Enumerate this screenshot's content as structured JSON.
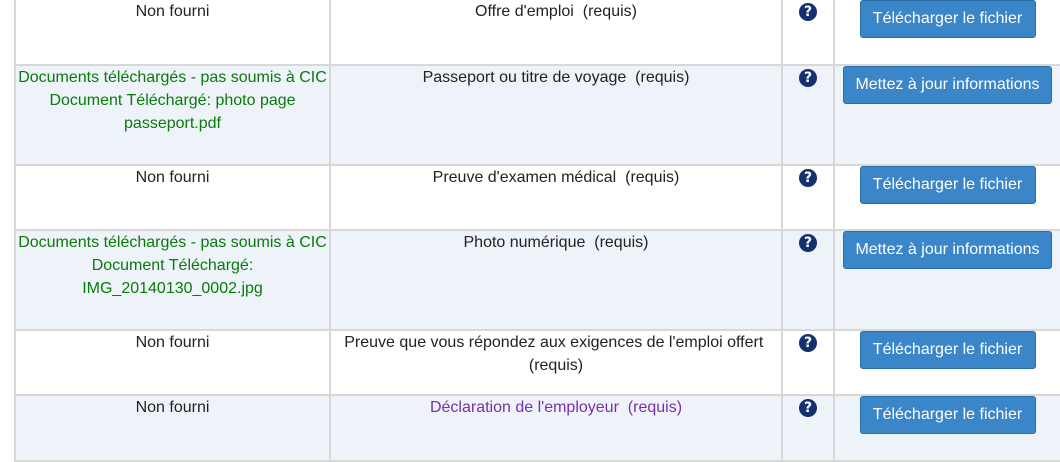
{
  "rows": [
    {
      "status_lines": [
        "Non fourni"
      ],
      "status_type": "not-provided",
      "document": "Offre d'emploi",
      "required": "(requis)",
      "help": "?",
      "action": "Télécharger le fichier"
    },
    {
      "status_lines": [
        "Documents téléchargés - pas soumis à CIC",
        "Document Téléchargé: photo page passeport.pdf"
      ],
      "status_type": "uploaded",
      "document": "Passeport ou titre de voyage",
      "required": "(requis)",
      "help": "?",
      "action": "Mettez à jour informations"
    },
    {
      "status_lines": [
        "Non fourni"
      ],
      "status_type": "not-provided",
      "document": "Preuve d'examen médical",
      "required": "(requis)",
      "help": "?",
      "action": "Télécharger le fichier"
    },
    {
      "status_lines": [
        "Documents téléchargés - pas soumis à CIC",
        "Document Téléchargé: IMG_20140130_0002.jpg"
      ],
      "status_type": "uploaded",
      "document": "Photo numérique",
      "required": "(requis)",
      "help": "?",
      "action": "Mettez à jour informations"
    },
    {
      "status_lines": [
        "Non fourni"
      ],
      "status_type": "not-provided",
      "document": "Preuve que vous répondez aux exigences de l'emploi offert",
      "required": "(requis)",
      "help": "?",
      "action": "Télécharger le fichier"
    },
    {
      "status_lines": [
        "Non fourni"
      ],
      "status_type": "not-provided",
      "document": "Déclaration de l'employeur",
      "required": "(requis)",
      "help": "?",
      "action": "Télécharger le fichier"
    }
  ],
  "colors": {
    "uploaded_status": "#0a7a0a",
    "employer_declaration": "#7a2fa8",
    "button_bg": "#3a86c8",
    "help_icon": "#15306e",
    "row_alt_bg": "#eef3fa"
  }
}
